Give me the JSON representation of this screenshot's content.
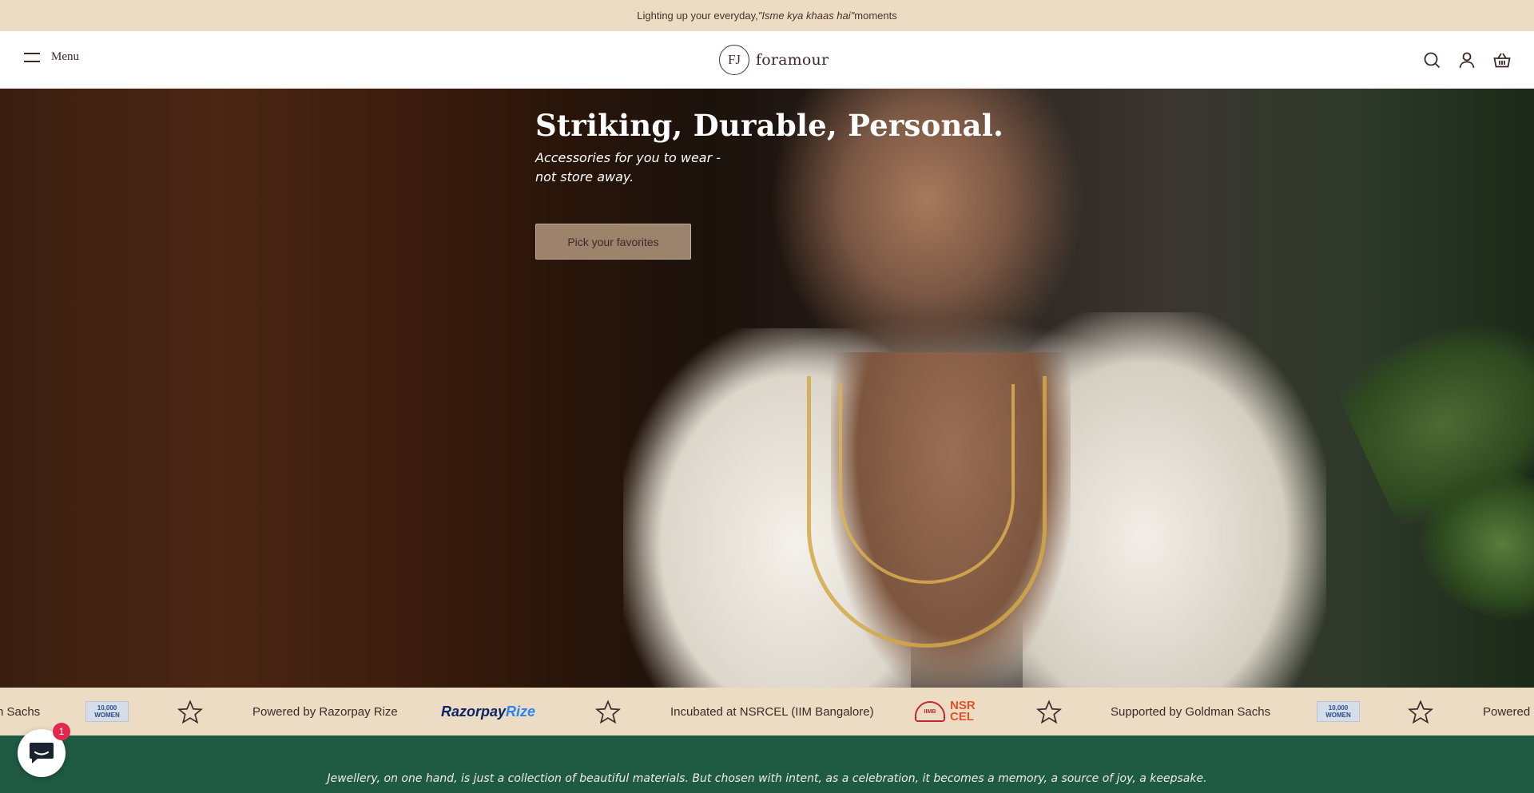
{
  "announcement": {
    "prefix": "Lighting up your everyday, ",
    "quote": "\"Isme kya khaas hai\"",
    "suffix": " moments"
  },
  "header": {
    "menu_label": "Menu",
    "logo_mark": "FJ",
    "logo_text": "foramour",
    "icons": [
      "search-icon",
      "account-icon",
      "basket-icon"
    ]
  },
  "hero": {
    "title": "Striking, Durable, Personal.",
    "subtitle": "Accessories for you to wear - not store away.",
    "cta_label": "Pick your favorites"
  },
  "marquee": {
    "items": [
      "Supported by Goldman Sachs",
      "Powered by Razorpay Rize",
      "Incubated at NSRCEL (IIM Bangalore)",
      "Supported by Goldman Sachs",
      "Powered by Razorpay Rize"
    ],
    "visible_fragments": {
      "left_cut": "n Sachs",
      "right_cut": "Powered b"
    },
    "badge_10k_line1": "10,000",
    "badge_10k_line2": "WOMEN",
    "razorpay_a": "Razorpay",
    "razorpay_b": "Rize",
    "nsrcel_text_1": "NSR",
    "nsrcel_text_2": "CEL"
  },
  "footer_band": {
    "quote": "Jewellery, on one hand, is just a collection of beautiful materials. But chosen with intent, as a celebration, it becomes a memory, a source of joy, a keepsake."
  },
  "chat": {
    "unread_count": "1"
  },
  "colors": {
    "announcement_bg": "#ecdcc4",
    "footer_bg": "#1f5b43",
    "text_brown": "#3b2a25",
    "badge_red": "#e3284f"
  }
}
